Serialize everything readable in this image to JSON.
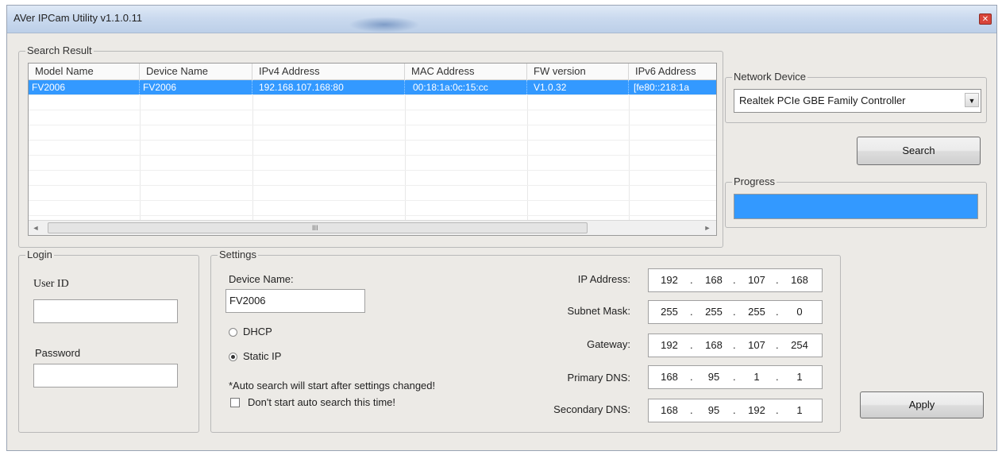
{
  "window": {
    "title": "AVer IPCam Utility v1.1.0.11",
    "close_glyph": "✕"
  },
  "search_result": {
    "label": "Search Result",
    "columns": [
      "Model Name",
      "Device Name",
      "IPv4 Address",
      "MAC Address",
      "FW version",
      "IPv6 Address"
    ],
    "rows": [
      [
        "FV2006",
        "FV2006",
        "192.168.107.168:80",
        "00:18:1a:0c:15:cc",
        "V1.0.32",
        "[fe80::218:1a"
      ]
    ],
    "scroll_left": "◄",
    "scroll_right": "►",
    "scroll_grip": "III"
  },
  "network_device": {
    "label": "Network Device",
    "selected": "Realtek PCIe GBE Family Controller",
    "dropdown_glyph": "▼"
  },
  "search_button": "Search",
  "progress": {
    "label": "Progress",
    "fraction": 1.0,
    "color": "#3399ff"
  },
  "login": {
    "label": "Login",
    "user_id_label": "User ID",
    "user_id_value": "",
    "password_label": "Password",
    "password_value": ""
  },
  "settings": {
    "label": "Settings",
    "device_name_label": "Device Name:",
    "device_name_value": "FV2006",
    "dhcp_label": "DHCP",
    "static_ip_label": "Static IP",
    "mode_selected": "Static IP",
    "note": "*Auto search will start after settings changed!",
    "no_auto_search_label": "Don't start auto search this time!",
    "no_auto_search_checked": false,
    "ip_address_label": "IP Address:",
    "ip_address": [
      "192",
      "168",
      "107",
      "168"
    ],
    "subnet_mask_label": "Subnet Mask:",
    "subnet_mask": [
      "255",
      "255",
      "255",
      "0"
    ],
    "gateway_label": "Gateway:",
    "gateway": [
      "192",
      "168",
      "107",
      "254"
    ],
    "primary_dns_label": "Primary DNS:",
    "primary_dns": [
      "168",
      "95",
      "1",
      "1"
    ],
    "secondary_dns_label": "Secondary DNS:",
    "secondary_dns": [
      "168",
      "95",
      "192",
      "1"
    ]
  },
  "apply_button": "Apply"
}
